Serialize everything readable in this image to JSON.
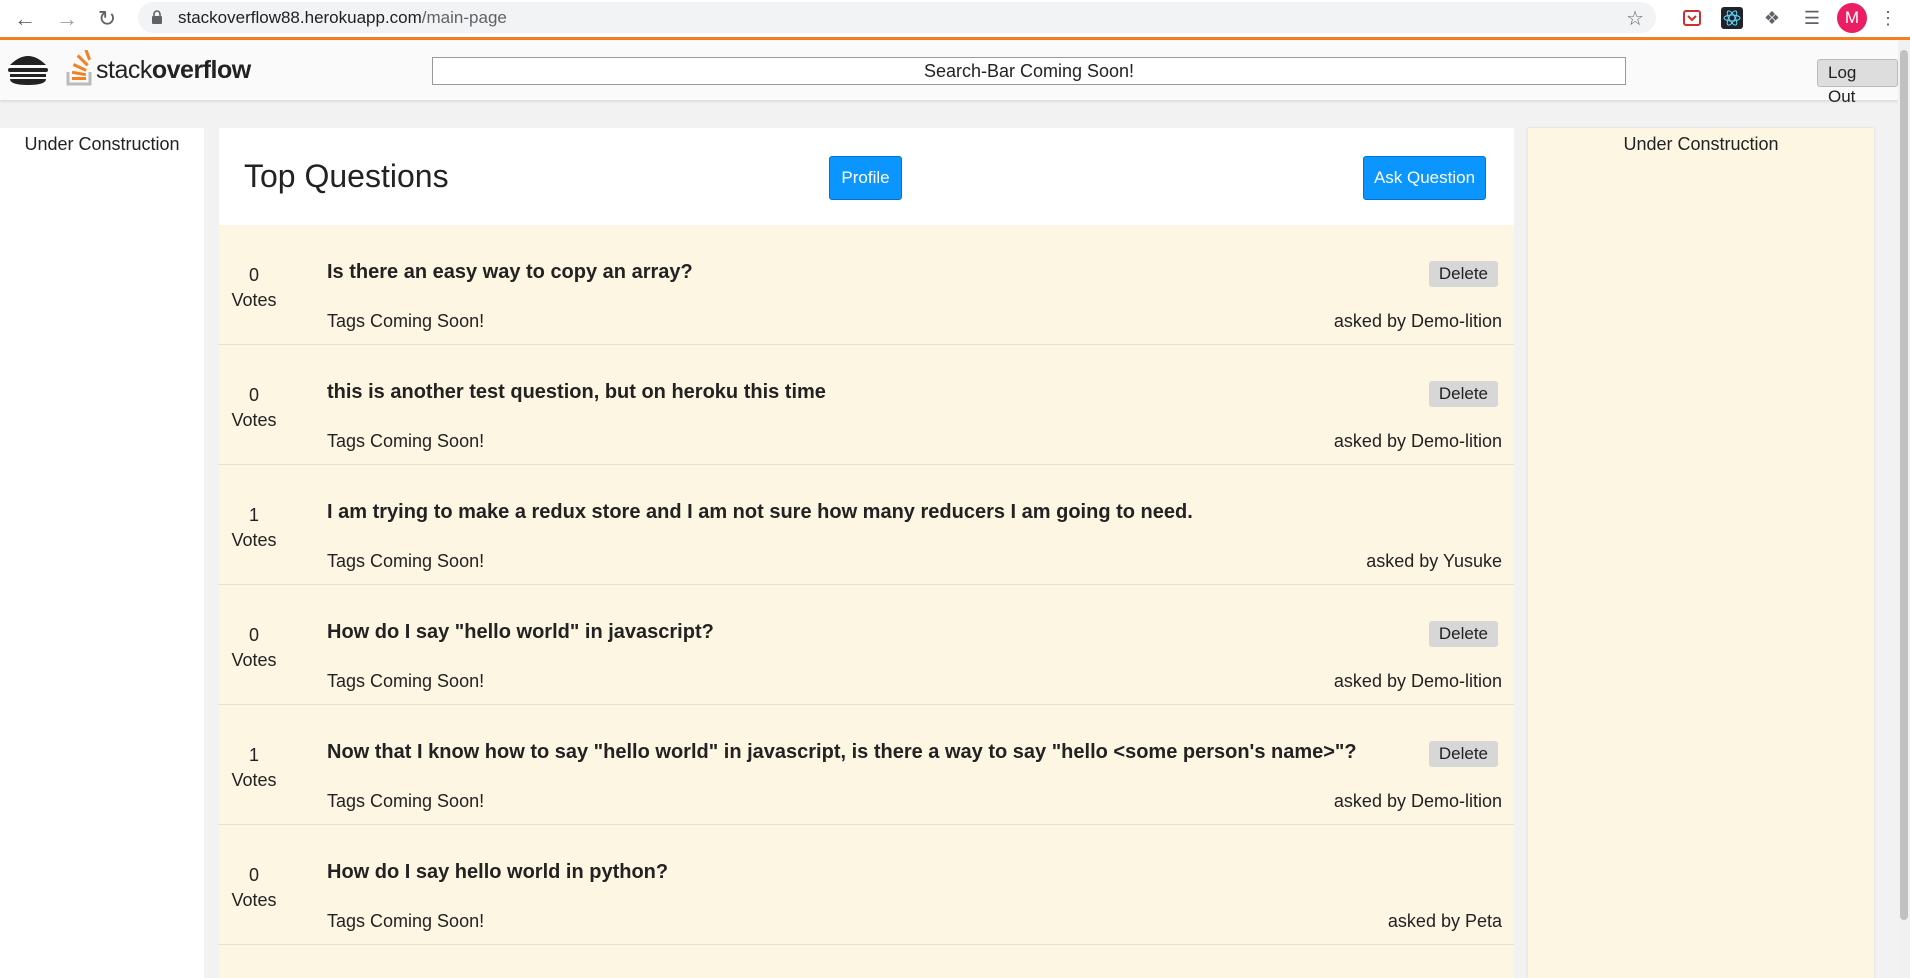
{
  "browser": {
    "url_domain": "stackoverflow88.herokuapp.com",
    "url_path": "/main-page",
    "avatar_letter": "M"
  },
  "header": {
    "logo_light": "stack",
    "logo_bold": "overflow",
    "search_text": "Search-Bar Coming Soon!",
    "logout_label": "Log Out"
  },
  "left_sidebar": {
    "text": "Under Construction"
  },
  "right_sidebar": {
    "text": "Under Construction"
  },
  "main": {
    "title": "Top Questions",
    "profile_label": "Profile",
    "ask_label": "Ask Question",
    "questions": [
      {
        "votes": "0",
        "votes_label": "Votes",
        "title": "Is there an easy way to copy an array?",
        "tags": "Tags Coming Soon!",
        "asked": "asked by Demo-lition",
        "delete": "Delete"
      },
      {
        "votes": "0",
        "votes_label": "Votes",
        "title": "this is another test question, but on heroku this time",
        "tags": "Tags Coming Soon!",
        "asked": "asked by Demo-lition",
        "delete": "Delete"
      },
      {
        "votes": "1",
        "votes_label": "Votes",
        "title": "I am trying to make a redux store and I am not sure how many reducers I am going to need.",
        "tags": "Tags Coming Soon!",
        "asked": "asked by Yusuke"
      },
      {
        "votes": "0",
        "votes_label": "Votes",
        "title": "How do I say \"hello world\" in javascript?",
        "tags": "Tags Coming Soon!",
        "asked": "asked by Demo-lition",
        "delete": "Delete"
      },
      {
        "votes": "1",
        "votes_label": "Votes",
        "title": "Now that I know how to say \"hello world\" in javascript, is there a way to say \"hello <some person's name>\"?",
        "tags": "Tags Coming Soon!",
        "asked": "asked by Demo-lition",
        "delete": "Delete"
      },
      {
        "votes": "0",
        "votes_label": "Votes",
        "title": "How do I say hello world in python?",
        "tags": "Tags Coming Soon!",
        "asked": "asked by Peta"
      }
    ]
  },
  "colors": {
    "accent": "#f48024",
    "button_blue": "#0a95ff",
    "question_bg": "#fdf6e3"
  }
}
